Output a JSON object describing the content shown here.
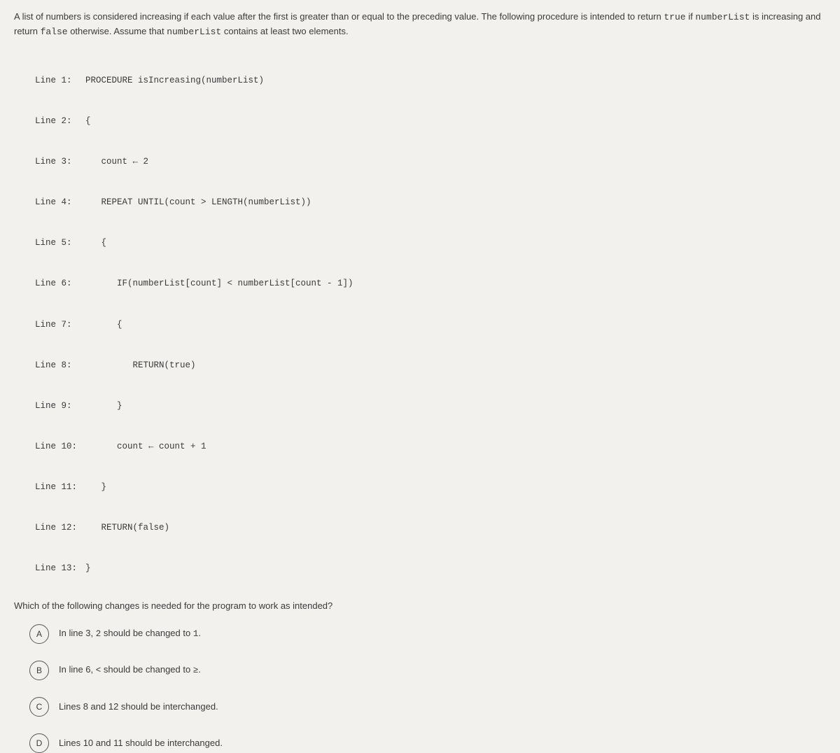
{
  "intro": {
    "part1": "A list of numbers is considered increasing if each value after the first is greater than or equal to the preceding value. The following procedure is intended to return ",
    "true": "true",
    "part2": " if ",
    "numlist1": "numberList",
    "part3": " is increasing and return ",
    "false": "false",
    "part4": " otherwise. Assume that ",
    "numlist2": "numberList",
    "part5": " contains at least two elements."
  },
  "code": [
    {
      "ln": "Line 1:",
      "txt": "PROCEDURE isIncreasing(numberList)"
    },
    {
      "ln": "Line 2:",
      "txt": "{"
    },
    {
      "ln": "Line 3:",
      "txt": "   count ← 2"
    },
    {
      "ln": "Line 4:",
      "txt": "   REPEAT UNTIL(count > LENGTH(numberList))"
    },
    {
      "ln": "Line 5:",
      "txt": "   {"
    },
    {
      "ln": "Line 6:",
      "txt": "      IF(numberList[count] < numberList[count - 1])"
    },
    {
      "ln": "Line 7:",
      "txt": "      {"
    },
    {
      "ln": "Line 8:",
      "txt": "         RETURN(true)"
    },
    {
      "ln": "Line 9:",
      "txt": "      }"
    },
    {
      "ln": "Line 10:",
      "txt": "      count ← count + 1"
    },
    {
      "ln": "Line 11:",
      "txt": "   }"
    },
    {
      "ln": "Line 12:",
      "txt": "   RETURN(false)"
    },
    {
      "ln": "Line 13:",
      "txt": "}"
    }
  ],
  "followup": "Which of the following changes is needed for the program to work as intended?",
  "choices": {
    "a": {
      "letter": "A",
      "p1": "In line 3, ",
      "m1": "2",
      "p2": " should be changed to ",
      "m2": "1",
      "p3": "."
    },
    "b": {
      "letter": "B",
      "p1": "In line 6, ",
      "m1": "<",
      "p2": " should be changed to ",
      "m2": "≥",
      "p3": "."
    },
    "c": {
      "letter": "C",
      "p1": "Lines 8 and 12 should be interchanged."
    },
    "d": {
      "letter": "D",
      "p1": "Lines 10 and 11 should be interchanged."
    }
  }
}
